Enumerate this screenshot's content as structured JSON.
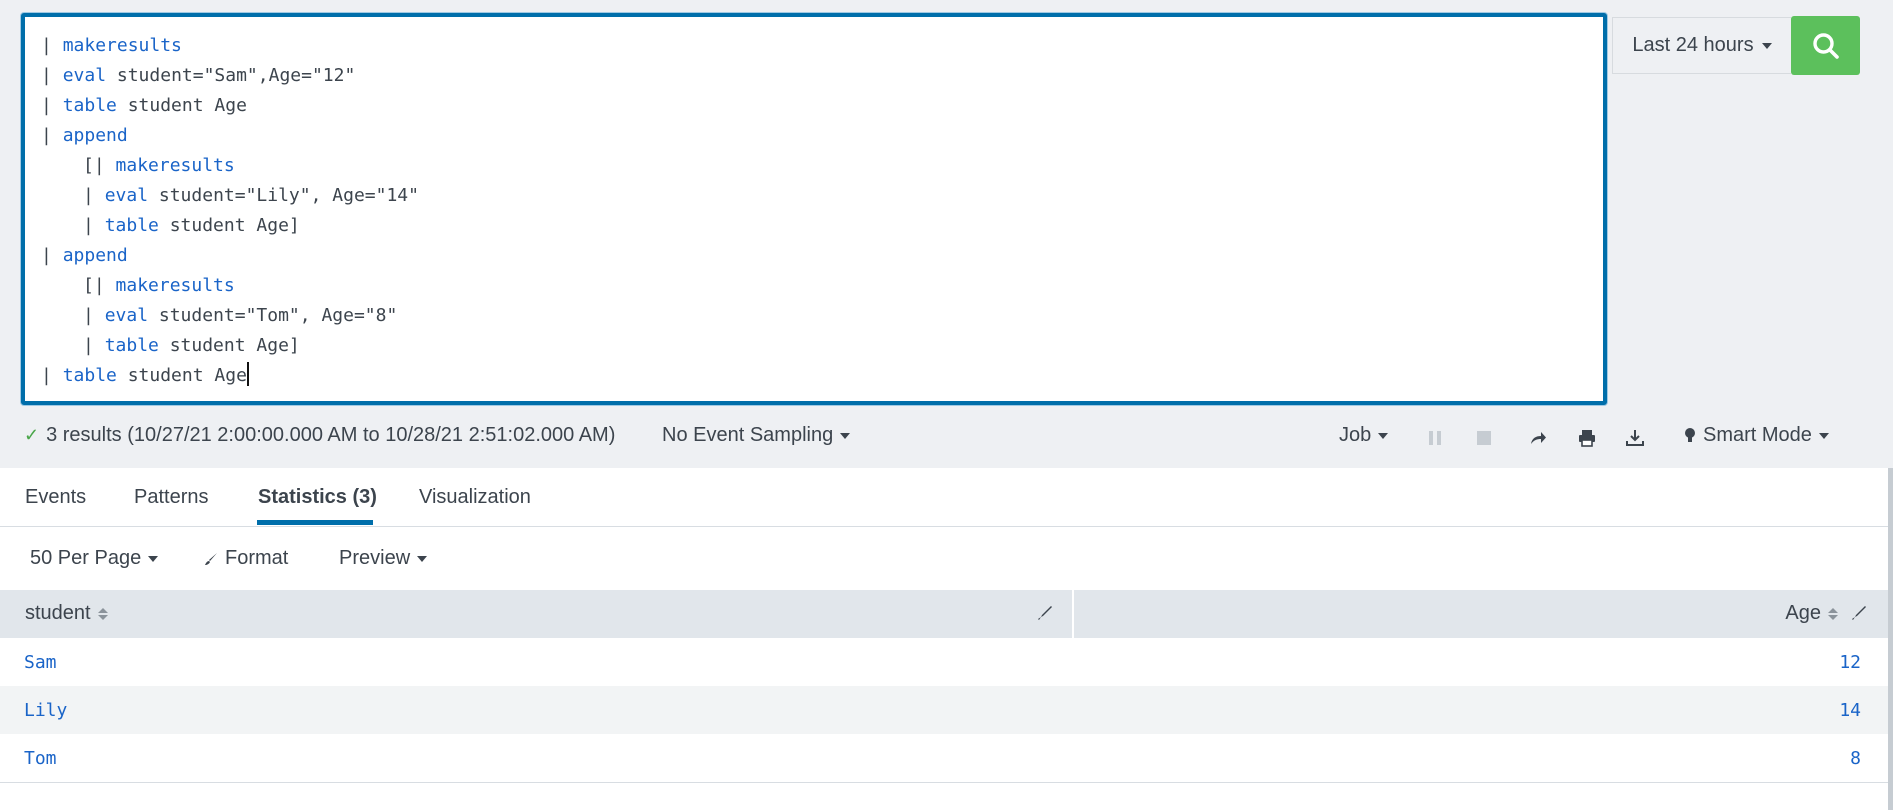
{
  "query": {
    "lines": [
      {
        "indent": 0,
        "tokens": [
          {
            "t": "| ",
            "k": "pipe"
          },
          {
            "t": "makeresults",
            "k": "kw"
          }
        ]
      },
      {
        "indent": 0,
        "tokens": [
          {
            "t": "| ",
            "k": "pipe"
          },
          {
            "t": "eval",
            "k": "kw"
          },
          {
            "t": " student=\"Sam\",Age=\"12\"",
            "k": "txt"
          }
        ]
      },
      {
        "indent": 0,
        "tokens": [
          {
            "t": "| ",
            "k": "pipe"
          },
          {
            "t": "table",
            "k": "kw"
          },
          {
            "t": " student Age",
            "k": "txt"
          }
        ]
      },
      {
        "indent": 0,
        "tokens": [
          {
            "t": "| ",
            "k": "pipe"
          },
          {
            "t": "append",
            "k": "kw"
          }
        ]
      },
      {
        "indent": 1,
        "tokens": [
          {
            "t": "[| ",
            "k": "pipe"
          },
          {
            "t": "makeresults",
            "k": "kw"
          }
        ]
      },
      {
        "indent": 1,
        "tokens": [
          {
            "t": "| ",
            "k": "pipe"
          },
          {
            "t": "eval",
            "k": "kw"
          },
          {
            "t": " student=\"Lily\", Age=\"14\"",
            "k": "txt"
          }
        ]
      },
      {
        "indent": 1,
        "tokens": [
          {
            "t": "| ",
            "k": "pipe"
          },
          {
            "t": "table",
            "k": "kw"
          },
          {
            "t": " student Age]",
            "k": "txt"
          }
        ]
      },
      {
        "indent": 0,
        "tokens": [
          {
            "t": "| ",
            "k": "pipe"
          },
          {
            "t": "append",
            "k": "kw"
          }
        ]
      },
      {
        "indent": 1,
        "tokens": [
          {
            "t": "[| ",
            "k": "pipe"
          },
          {
            "t": "makeresults",
            "k": "kw"
          }
        ]
      },
      {
        "indent": 1,
        "tokens": [
          {
            "t": "| ",
            "k": "pipe"
          },
          {
            "t": "eval",
            "k": "kw"
          },
          {
            "t": " student=\"Tom\", Age=\"8\"",
            "k": "txt"
          }
        ]
      },
      {
        "indent": 1,
        "tokens": [
          {
            "t": "| ",
            "k": "pipe"
          },
          {
            "t": "table",
            "k": "kw"
          },
          {
            "t": " student Age]",
            "k": "txt"
          }
        ]
      },
      {
        "indent": 0,
        "tokens": [
          {
            "t": "| ",
            "k": "pipe"
          },
          {
            "t": "table",
            "k": "kw"
          },
          {
            "t": " student Age",
            "k": "txt"
          }
        ],
        "caret": true
      }
    ]
  },
  "time_picker": {
    "label": "Last 24 hours"
  },
  "status": {
    "results": "3 results (10/27/21 2:00:00.000 AM to 10/28/21 2:51:02.000 AM)",
    "sampling": "No Event Sampling",
    "job": "Job",
    "mode": "Smart Mode"
  },
  "tabs": {
    "events": "Events",
    "patterns": "Patterns",
    "statistics": "Statistics (3)",
    "visualization": "Visualization"
  },
  "controls": {
    "per_page": "50 Per Page",
    "format": "Format",
    "preview": "Preview"
  },
  "table": {
    "headers": {
      "student": "student",
      "age": "Age"
    },
    "rows": [
      {
        "student": "Sam",
        "age": "12"
      },
      {
        "student": "Lily",
        "age": "14"
      },
      {
        "student": "Tom",
        "age": "8"
      }
    ]
  },
  "colors": {
    "accent": "#006eaa",
    "search_button": "#5cc05c",
    "keyword": "#1a64c8"
  }
}
